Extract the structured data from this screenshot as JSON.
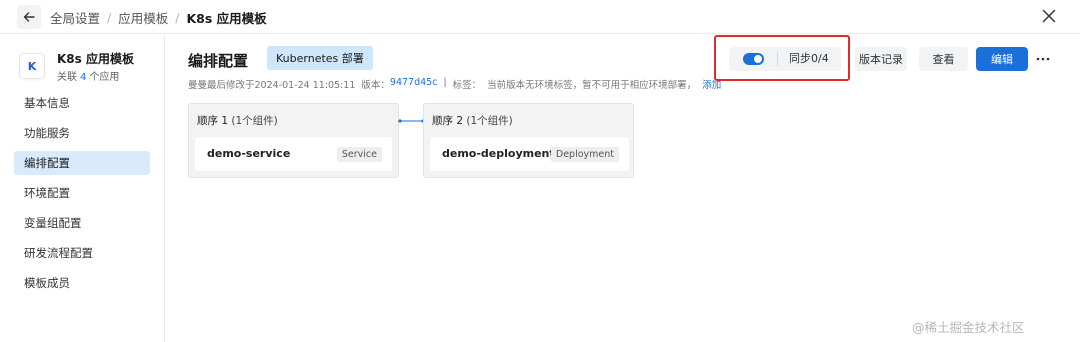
{
  "topbar": {
    "breadcrumbs": [
      "全局设置",
      "应用模板"
    ],
    "current": "K8s 应用模板",
    "separator": "/"
  },
  "sidebar": {
    "app_avatar": "K",
    "app_name": "K8s 应用模板",
    "app_sub_prefix": "关联",
    "app_sub_count": "4",
    "app_sub_suffix": "个应用",
    "items": [
      {
        "label": "基本信息",
        "active": false
      },
      {
        "label": "功能服务",
        "active": false
      },
      {
        "label": "编排配置",
        "active": true
      },
      {
        "label": "环境配置",
        "active": false
      },
      {
        "label": "变量组配置",
        "active": false
      },
      {
        "label": "研发流程配置",
        "active": false
      },
      {
        "label": "模板成员",
        "active": false
      }
    ]
  },
  "main": {
    "title": "编排配置",
    "tag": "Kubernetes 部署",
    "meta_modified": "曼曼最后修改于2024-01-24 11:05:11",
    "meta_version_label": "版本：",
    "meta_version_value": "9477d45c",
    "meta_sep": "|",
    "meta_tags_label": "标签：",
    "meta_tags_desc": "当前版本无环境标签，暂不可用于相应环境部署，",
    "meta_add_link": "添加"
  },
  "toolbar": {
    "sync_enabled": true,
    "sync_label": "同步0/4",
    "version_record_label": "版本记录",
    "view_label": "查看",
    "edit_label": "编辑",
    "more_icon": "ellipsis-icon"
  },
  "stages": [
    {
      "title": "顺序 1",
      "count": "(1个组件)",
      "component": "demo-service",
      "type": "Service"
    },
    {
      "title": "顺序 2",
      "count": "(1个组件)",
      "component": "demo-deployment",
      "type": "Deployment"
    }
  ],
  "watermark": "@稀土掘金技术社区",
  "colors": {
    "primary": "#1b6fd8",
    "tag_bg": "#cfe6fb",
    "nav_active_bg": "#d9eafd",
    "highlight": "#e02b2b"
  }
}
